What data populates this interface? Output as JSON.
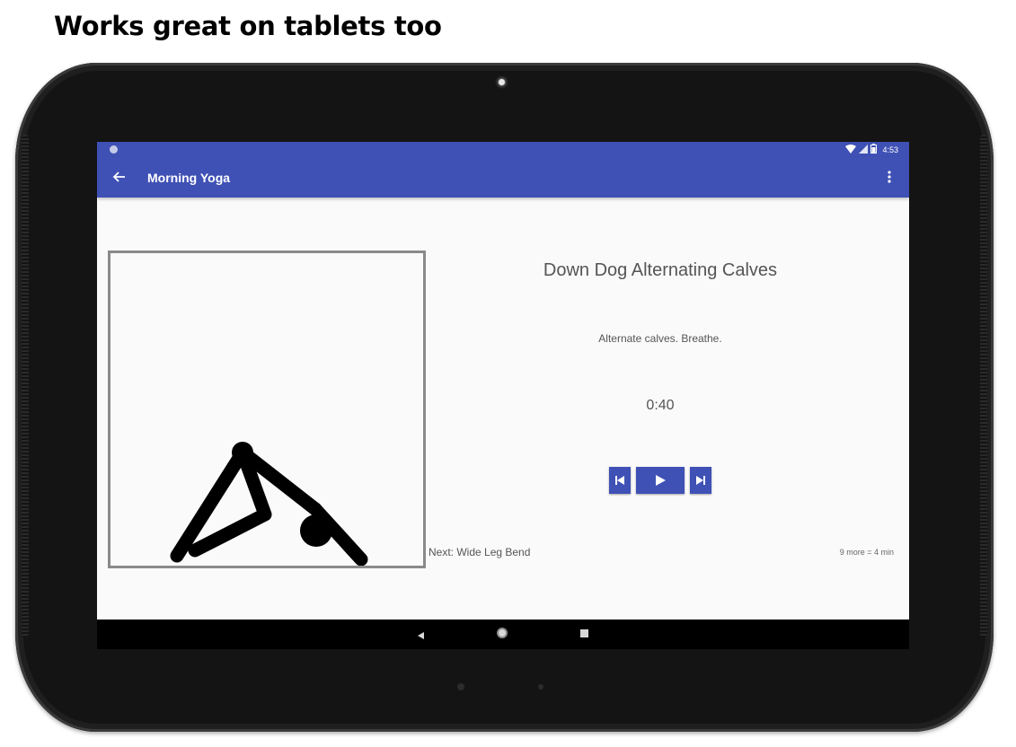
{
  "headline": "Works great on tablets too",
  "status_bar": {
    "time": "4:53",
    "icons": [
      "notification-dot-icon",
      "wifi-icon",
      "signal-icon",
      "battery-icon"
    ]
  },
  "app_bar": {
    "title": "Morning Yoga",
    "back_icon": "arrow-left-icon",
    "menu_icon": "more-vert-icon",
    "color": "#3f51b5"
  },
  "exercise": {
    "name": "Down Dog Alternating Calves",
    "description": "Alternate calves. Breathe.",
    "timer": "0:40",
    "illustration": "stick-figure-down-dog-icon"
  },
  "controls": {
    "previous": "skip-previous-icon",
    "play": "play-icon",
    "next": "skip-next-icon"
  },
  "next_label": "Next: Wide Leg Bend",
  "remaining": "9 more = 4 min",
  "nav_bar": {
    "icons": [
      "nav-back-icon",
      "nav-home-icon",
      "nav-recents-icon"
    ]
  }
}
